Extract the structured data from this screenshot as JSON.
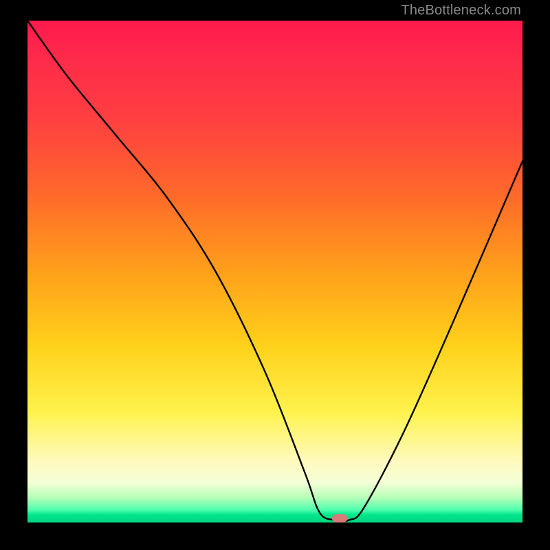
{
  "watermark": "TheBottleneck.com",
  "marker": {
    "x_pct": 63,
    "y_pct": 99.2
  },
  "chart_data": {
    "type": "line",
    "title": "",
    "xlabel": "",
    "ylabel": "",
    "xlim": [
      0,
      100
    ],
    "ylim": [
      0,
      100
    ],
    "grid": false,
    "annotations": [
      "TheBottleneck.com"
    ],
    "series": [
      {
        "name": "bottleneck-curve",
        "x": [
          0,
          8,
          18,
          28,
          38,
          48,
          56,
          59,
          62,
          65,
          68,
          76,
          86,
          100
        ],
        "values": [
          100,
          89,
          77,
          65,
          50,
          30,
          10,
          2,
          0.5,
          0.5,
          3,
          18,
          40,
          72
        ]
      }
    ],
    "background_gradient": {
      "stops": [
        {
          "pct": 0,
          "color": "#ff1a4d"
        },
        {
          "pct": 50,
          "color": "#ffa01a"
        },
        {
          "pct": 78,
          "color": "#fff24d"
        },
        {
          "pct": 95,
          "color": "#b8ffb8"
        },
        {
          "pct": 100,
          "color": "#00d680"
        }
      ]
    },
    "marker": {
      "x": 63,
      "y": 0.8,
      "color": "#d87a78"
    }
  }
}
